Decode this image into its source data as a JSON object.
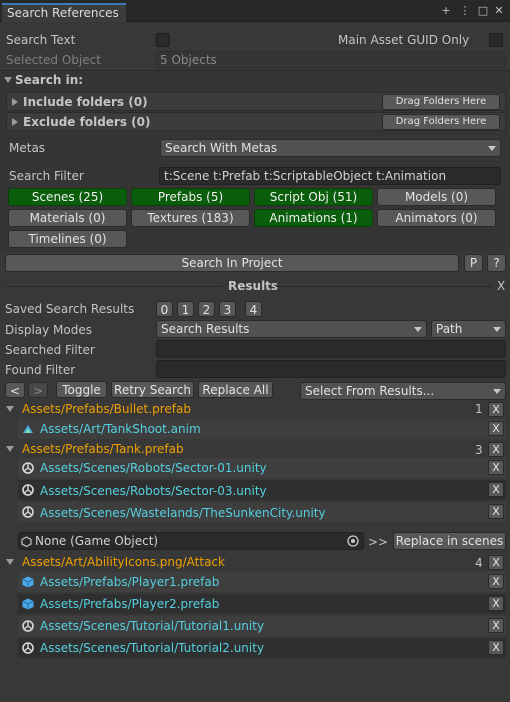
{
  "window": {
    "title": "Search References",
    "icons": [
      "plus-icon",
      "kebab-menu-icon",
      "maximize-icon",
      "close-icon"
    ]
  },
  "icons_glyph": {
    "plus": "+",
    "kebab": "⋮",
    "maximize": "□",
    "close": "✕"
  },
  "options": {
    "search_text_label": "Search Text",
    "main_asset_guid_label": "Main Asset GUID Only",
    "selected_object_label": "Selected Object",
    "selected_object_value": "5 Objects"
  },
  "search_in": {
    "header": "Search in:",
    "include_label": "Include folders (0)",
    "exclude_label": "Exclude folders (0)",
    "drag_label": "Drag Folders Here",
    "metas_label": "Metas",
    "metas_value": "Search With Metas",
    "filter_label": "Search Filter",
    "filter_value": "t:Scene t:Prefab t:ScriptableObject t:Animation",
    "types": [
      {
        "label": "Scenes (25)",
        "active": true
      },
      {
        "label": "Prefabs (5)",
        "active": true
      },
      {
        "label": "Script Obj (51)",
        "active": true
      },
      {
        "label": "Models (0)",
        "active": false
      },
      {
        "label": "Materials (0)",
        "active": false
      },
      {
        "label": "Textures (183)",
        "active": false
      },
      {
        "label": "Animations (1)",
        "active": true
      },
      {
        "label": "Animators (0)",
        "active": false
      },
      {
        "label": "Timelines (0)",
        "active": false
      }
    ]
  },
  "search_bar": {
    "button": "Search In Project",
    "p_button": "P",
    "help_button": "?"
  },
  "results": {
    "header": "Results",
    "close": "X",
    "saved_label": "Saved Search Results",
    "saved_slots": [
      "0",
      "1",
      "2",
      "3",
      "4"
    ],
    "display_label": "Display Modes",
    "display_value": "Search Results",
    "path_value": "Path",
    "searched_filter_label": "Searched Filter",
    "found_filter_label": "Found Filter",
    "prev": "<",
    "next": ">",
    "toggle": "Toggle",
    "retry": "Retry Search",
    "replace_all": "Replace All",
    "select_from": "Select From Results...",
    "groups": [
      {
        "path": "Assets/Prefabs/Bullet.prefab",
        "count": "1",
        "items": [
          {
            "icon": "animation-icon",
            "path": "Assets/Art/TankShoot.anim"
          }
        ]
      },
      {
        "path": "Assets/Prefabs/Tank.prefab",
        "count": "3",
        "items": [
          {
            "icon": "unity-scene-icon",
            "path": "Assets/Scenes/Robots/Sector-01.unity"
          },
          {
            "icon": "unity-scene-icon",
            "path": "Assets/Scenes/Robots/Sector-03.unity"
          },
          {
            "icon": "unity-scene-icon",
            "path": "Assets/Scenes/Wastelands/TheSunkenCity.unity"
          }
        ]
      },
      {
        "path": "Assets/Art/AbilityIcons.png/Attack",
        "count": "4",
        "items": [
          {
            "icon": "prefab-icon",
            "path": "Assets/Prefabs/Player1.prefab"
          },
          {
            "icon": "prefab-icon",
            "path": "Assets/Prefabs/Player2.prefab"
          },
          {
            "icon": "unity-scene-icon",
            "path": "Assets/Scenes/Tutorial/Tutorial1.unity"
          },
          {
            "icon": "unity-scene-icon",
            "path": "Assets/Scenes/Tutorial/Tutorial2.unity"
          }
        ]
      }
    ],
    "replace_row": {
      "object_value": "None (Game Object)",
      "arrows": ">>",
      "replace_button": "Replace in scenes"
    },
    "x_label": "X"
  },
  "colors": {
    "active_type": "#0a5d0a",
    "group_path": "#f0a000",
    "item_path": "#55d0e0",
    "tab_accent": "#3a79bb"
  }
}
